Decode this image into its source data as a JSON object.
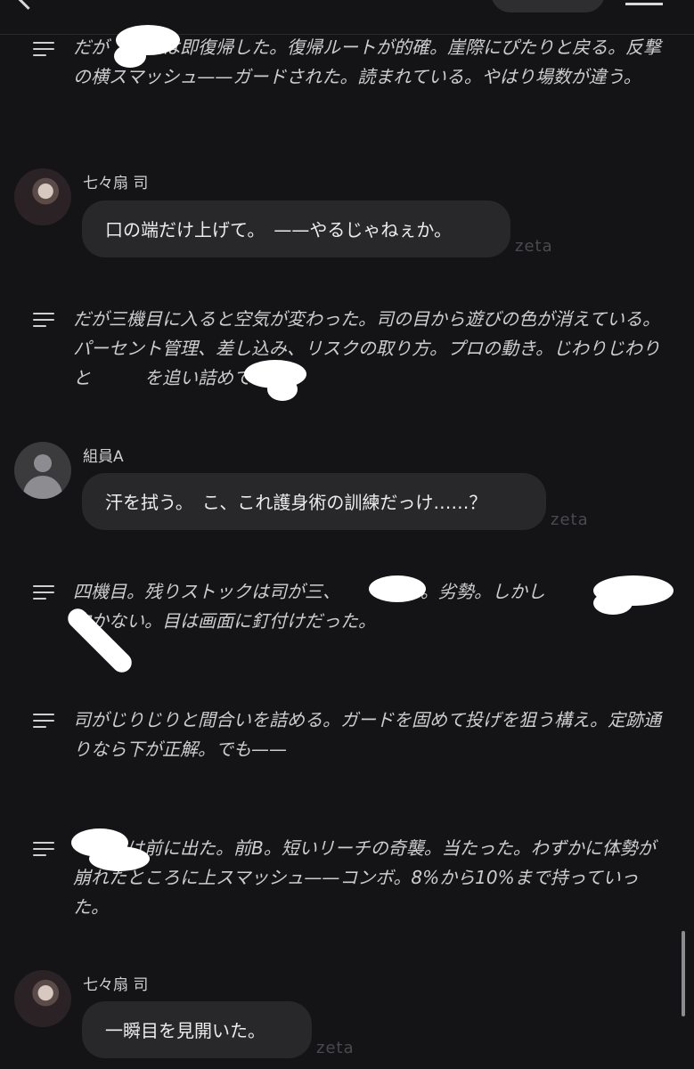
{
  "brand": "zeta",
  "narration": [
    {
      "text": "だが　　　は即復帰した。復帰ルートが的確。崖際にぴたりと戻る。反撃の横スマッシュ——ガードされた。読まれている。やはり場数が違う。"
    },
    {
      "text": "だが三機目に入ると空気が変わった。司の目から遊びの色が消えている。パーセント管理、差し込み、リスクの取り方。プロの動き。じわりじわりと　　　を追い詰めていく。"
    },
    {
      "text": "四機目。残りストックは司が三、　　　が二。劣勢。しかし　　　は下を向かない。目は画面に釘付けだった。"
    },
    {
      "text": "司がじりじりと間合いを詰める。ガードを固めて投げを狙う構え。定跡通りなら下が正解。でも——"
    },
    {
      "text": "　　　は前に出た。前B。短いリーチの奇襲。当たった。わずかに体勢が崩れたところに上スマッシュ——コンボ。8%から10%まで持っていった。"
    }
  ],
  "messages": [
    {
      "sender": "七々扇 司",
      "action": "口の端だけ上げて。",
      "speech": "——やるじゃねぇか。"
    },
    {
      "sender": "組員A",
      "action": "汗を拭う。",
      "speech": "こ、これ護身術の訓練だっけ……？"
    },
    {
      "sender": "七々扇 司",
      "action": "一瞬目を見開いた。",
      "speech": ""
    }
  ]
}
